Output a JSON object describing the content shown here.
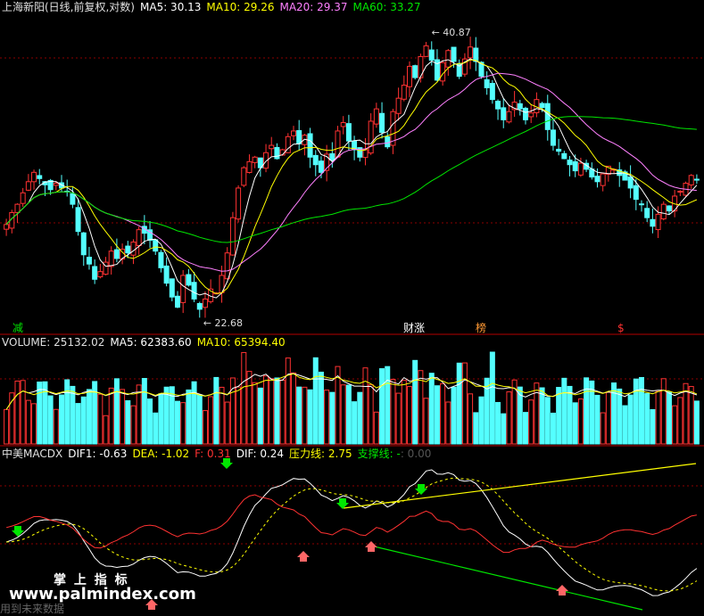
{
  "header": {
    "title": "上海新阳(日线,前复权,对数)",
    "ma5": "MA5: 30.13",
    "ma10": "MA10: 29.26",
    "ma20": "MA20: 29.37",
    "ma60": "MA60: 33.27"
  },
  "volume_header": {
    "label": "VOLUME: 25132.02",
    "ma5": "MA5: 62383.60",
    "ma10": "MA10: 65394.40"
  },
  "macd_header": {
    "name": "中美MACDX",
    "dif1": "DIF1: -0.63",
    "dea": "DEA: -1.02",
    "f": "F: 0.31",
    "dif": "DIF: 0.24",
    "pressure": "压力线: 2.75",
    "support": "支撑线: -",
    "support_val": ": 0.00"
  },
  "markers": {
    "high": "40.87",
    "low": "22.68",
    "reduce": "减",
    "tag_finance": "财",
    "tag_rise": "涨",
    "tag_list": "榜",
    "tag_s": "$"
  },
  "watermark": {
    "cn": "掌 上 指 标",
    "url": "www.palmindex.com",
    "sub": "用到未来数据"
  },
  "colors": {
    "up": "#ff3232",
    "down": "#54ffff",
    "ma5": "#ffffff",
    "ma10": "#ffff00",
    "ma20": "#ff80ff",
    "ma60": "#00e600",
    "grid": "#8b0000",
    "axis_divider": "#b40000"
  },
  "chart_data": {
    "type": "candlestick",
    "scale": "log",
    "price_high": 40.87,
    "price_low": 22.68,
    "closes": [
      27.4,
      28.1,
      28.6,
      29.3,
      30.0,
      30.6,
      30.2,
      29.8,
      29.5,
      29.9,
      29.6,
      29.4,
      28.6,
      27.0,
      25.7,
      25.2,
      24.4,
      24.8,
      25.3,
      25.9,
      25.5,
      26.0,
      25.8,
      26.4,
      27.1,
      26.9,
      26.5,
      25.9,
      25.0,
      24.2,
      23.5,
      23.0,
      24.6,
      24.1,
      23.4,
      22.9,
      23.4,
      23.9,
      23.7,
      24.6,
      25.8,
      27.8,
      29.6,
      30.9,
      31.3,
      31.6,
      30.9,
      31.9,
      32.4,
      31.5,
      32.1,
      33.0,
      33.4,
      32.5,
      33.1,
      31.6,
      31.1,
      30.6,
      31.8,
      31.4,
      33.4,
      34.0,
      32.7,
      32.1,
      31.6,
      32.1,
      34.1,
      35.0,
      33.3,
      32.3,
      34.8,
      35.8,
      36.8,
      38.3,
      37.4,
      39.1,
      40.0,
      38.8,
      37.2,
      38.6,
      39.6,
      38.7,
      37.5,
      38.9,
      39.9,
      38.7,
      37.5,
      36.6,
      35.7,
      35.0,
      34.2,
      34.8,
      35.5,
      35.0,
      34.2,
      34.7,
      35.7,
      35.1,
      33.5,
      32.4,
      32.0,
      31.5,
      31.1,
      30.7,
      31.2,
      30.8,
      30.3,
      30.0,
      30.5,
      31.0,
      30.8,
      30.4,
      30.1,
      29.6,
      28.9,
      28.6,
      27.8,
      27.3,
      28.0,
      28.6,
      28.2,
      29.1,
      29.4,
      29.9,
      30.4,
      30.1
    ],
    "volume_ma5": 62383.6,
    "volume_ma10": 65394.4,
    "volume_last": 25132.02,
    "indicator": {
      "name": "中美MACDX",
      "dif1": -0.63,
      "dea": -1.02,
      "f": 0.31,
      "dif": 0.24,
      "pressure_line": 2.75,
      "support_line": 0.0
    }
  }
}
